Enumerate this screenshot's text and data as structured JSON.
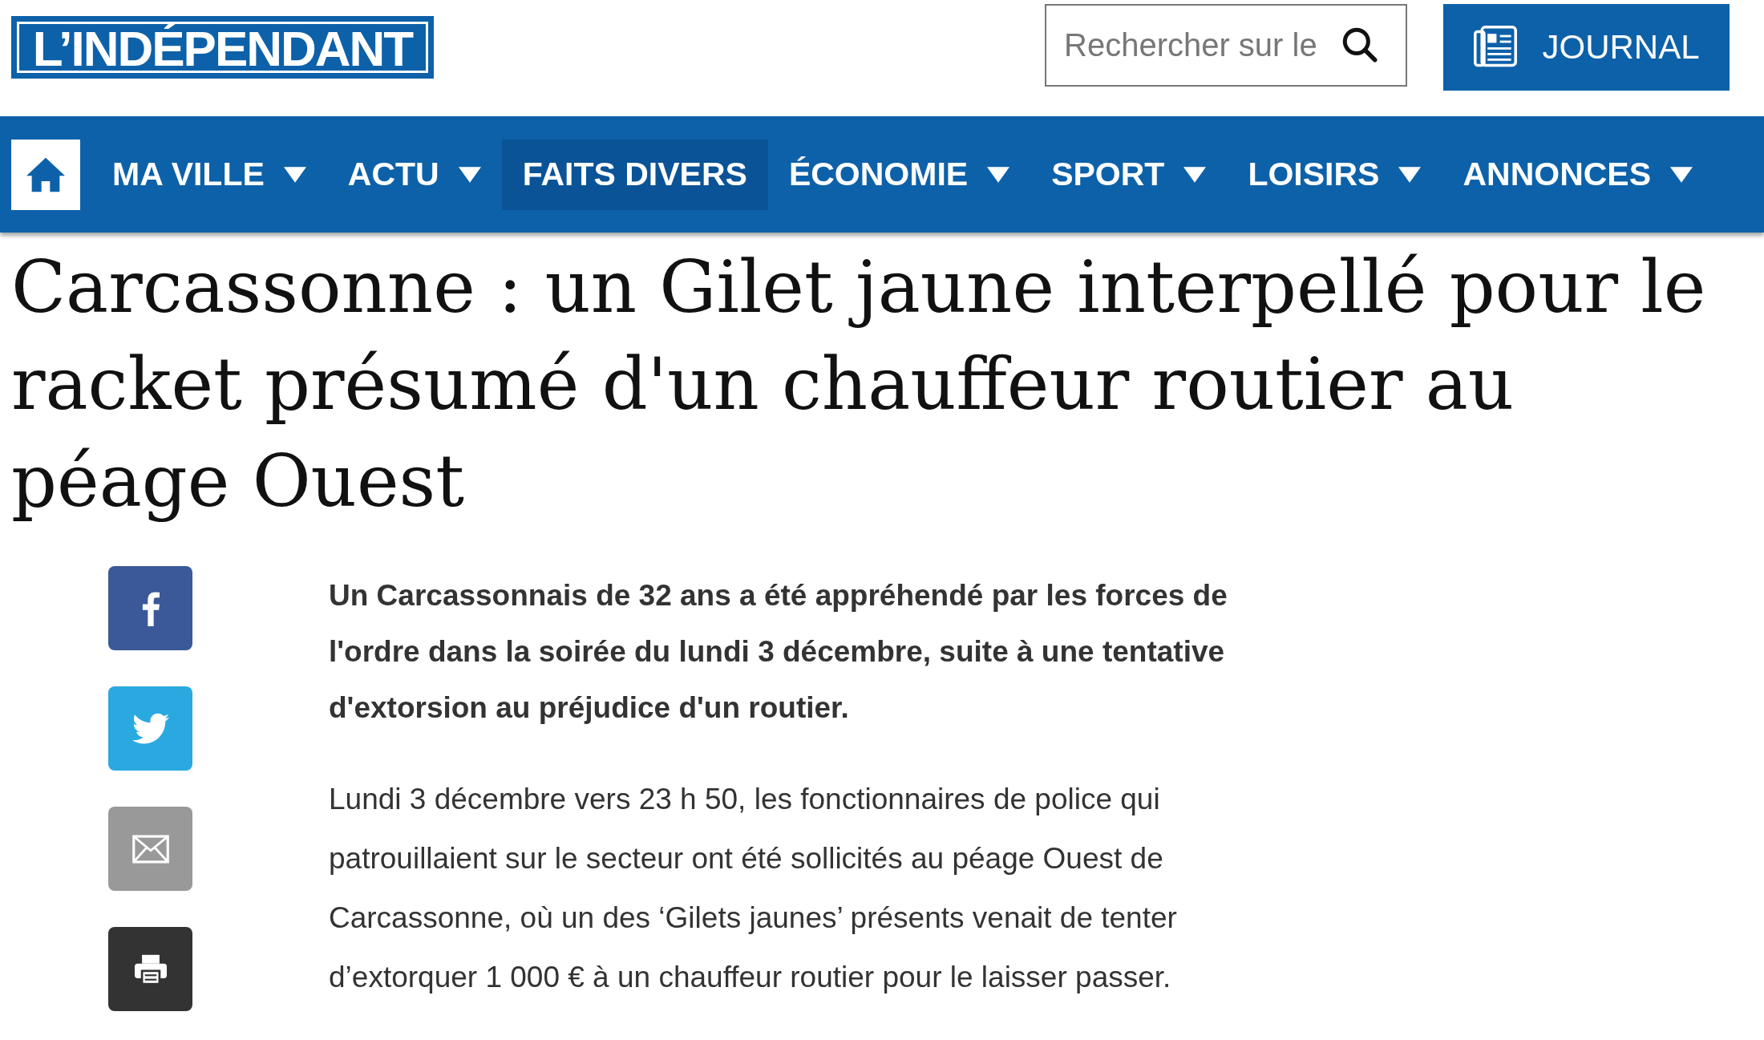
{
  "header": {
    "logo": "L’INDÉPENDANT",
    "search": {
      "placeholder": "Rechercher sur le"
    },
    "journal_button": "JOURNAL"
  },
  "nav": {
    "items": [
      {
        "label": "MA VILLE",
        "dropdown": true,
        "selected": false
      },
      {
        "label": "ACTU",
        "dropdown": true,
        "selected": false
      },
      {
        "label": "FAITS DIVERS",
        "dropdown": false,
        "selected": true
      },
      {
        "label": "ÉCONOMIE",
        "dropdown": true,
        "selected": false
      },
      {
        "label": "SPORT",
        "dropdown": true,
        "selected": false
      },
      {
        "label": "LOISIRS",
        "dropdown": true,
        "selected": false
      },
      {
        "label": "ANNONCES",
        "dropdown": true,
        "selected": false
      }
    ]
  },
  "article": {
    "headline": "Carcassonne : un Gilet jaune interpellé pour le racket présumé d'un chauffeur routier au péage Ouest",
    "share_buttons": [
      {
        "kind": "facebook"
      },
      {
        "kind": "twitter"
      },
      {
        "kind": "email"
      },
      {
        "kind": "print"
      }
    ],
    "lead": "Un Carcassonnais de 32 ans a été appréhendé par les forces de l'ordre dans la soirée du lundi 3 décembre, suite à une tentative d'extorsion au préjudice d'un routier.",
    "paragraphs": [
      "Lundi 3 décembre vers 23 h 50, les fonctionnaires de police qui patrouillaient sur le secteur ont été sollicités au péage Ouest de Carcassonne, où un des ‘Gilets jaunes’ présents venait de tenter d’extorquer 1 000 € à un chauffeur routier pour le laisser passer."
    ]
  }
}
